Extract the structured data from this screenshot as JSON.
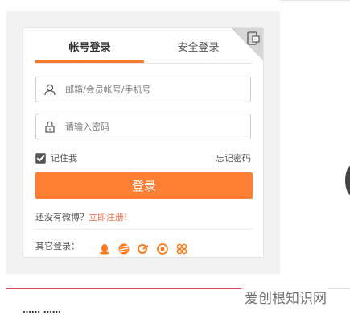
{
  "tabs": {
    "account": "帐号登录",
    "secure": "安全登录"
  },
  "form": {
    "username_placeholder": "邮箱/会员帐号/手机号",
    "password_placeholder": "请输入密码",
    "remember_label": "记住我",
    "remember_checked": true,
    "forgot_label": "忘记密码",
    "login_label": "登录"
  },
  "register": {
    "prompt": "还没有微博？",
    "link": "立即注册!"
  },
  "other_login": {
    "label": "其它登录：",
    "providers": [
      "qq-icon",
      "sina-icon",
      "taobao-icon",
      "360-icon",
      "alipay-icon"
    ]
  },
  "watermark": "爱创根知识网",
  "bottom_text": "…… ……",
  "colors": {
    "accent": "#ff8033",
    "link": "#eb7350",
    "icon": "#ff7a1c"
  }
}
